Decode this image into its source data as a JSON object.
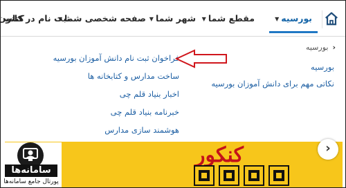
{
  "nav": {
    "home_icon": "home-icon",
    "items": [
      {
        "label": "بورسیه",
        "has_caret": true,
        "active": true
      },
      {
        "label": "مقطع شما",
        "has_caret": true,
        "active": false
      },
      {
        "label": "شهر شما",
        "has_caret": true,
        "active": false
      },
      {
        "label": "صفحه شخصی شما",
        "has_caret": true,
        "active": false
      },
      {
        "label": "ثبت نام در کانون",
        "has_caret": true,
        "active": false
      },
      {
        "label": "کتاب",
        "has_caret": false,
        "active": false
      }
    ],
    "caret_glyph": "▼"
  },
  "dropdown": {
    "breadcrumb": "بورسیه",
    "right_links": [
      "بورسیه",
      "نکاتی مهم برای دانش آموزان بورسیه"
    ],
    "mid_links": [
      "فراخوان ثبت نام دانش آموزان بورسیه",
      "ساخت مدارس و کتابخانه ها",
      "اخبار بنیاد قلم چی",
      "خبرنامه بنیاد قلم چی",
      "هوشمند سازی مدارس"
    ],
    "annotation_color": "#d0161c"
  },
  "banner": {
    "title": "کنکور",
    "bg_color": "#f7c61b",
    "next_icon": "chevron-right-icon",
    "next_glyph": "›"
  },
  "logo": {
    "name": "سامانه‌ها",
    "tagline": "پورتال جامع سامانه‌ها"
  }
}
